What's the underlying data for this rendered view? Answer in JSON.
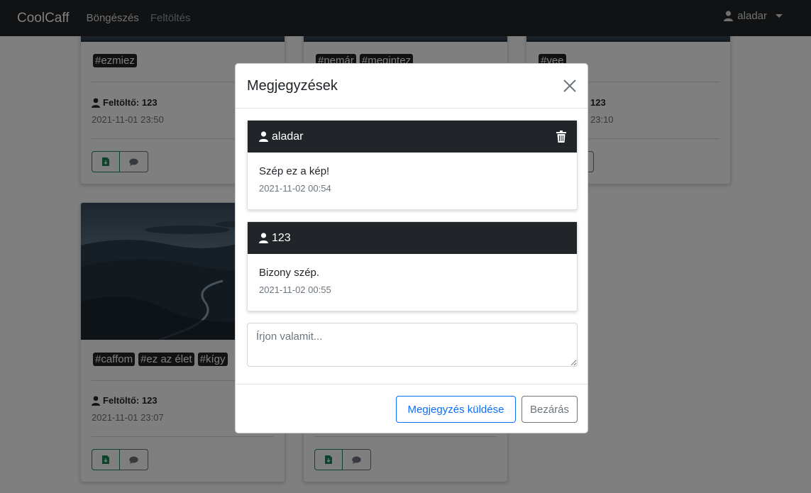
{
  "navbar": {
    "brand": "CoolCaff",
    "links": [
      "Böngészés",
      "Feltöltés"
    ],
    "user": "aladar"
  },
  "cards": [
    {
      "tags": [
        "#ezmiez"
      ],
      "uploader": "Feltöltő: 123",
      "date": "2021-11-01 23:50"
    },
    {
      "tags": [
        "#nemár",
        "#megintez"
      ]
    },
    {
      "tags": [
        "#vee"
      ],
      "uploader": "123",
      "date": "23:10"
    },
    {
      "tags": [
        "#caffom",
        "#ez az élet",
        "#kígy"
      ],
      "uploader": "Feltöltő: 123",
      "date": "2021-11-01 23:07"
    }
  ],
  "modal": {
    "title": "Megjegyzések",
    "comments": [
      {
        "author": "aladar",
        "text": "Szép ez a kép!",
        "date": "2021-11-02 00:54"
      },
      {
        "author": "123",
        "text": "Bizony szép.",
        "date": "2021-11-02 00:55"
      }
    ],
    "input_placeholder": "Írjon valamit...",
    "send_label": "Megjegyzés küldése",
    "close_label": "Bezárás"
  }
}
